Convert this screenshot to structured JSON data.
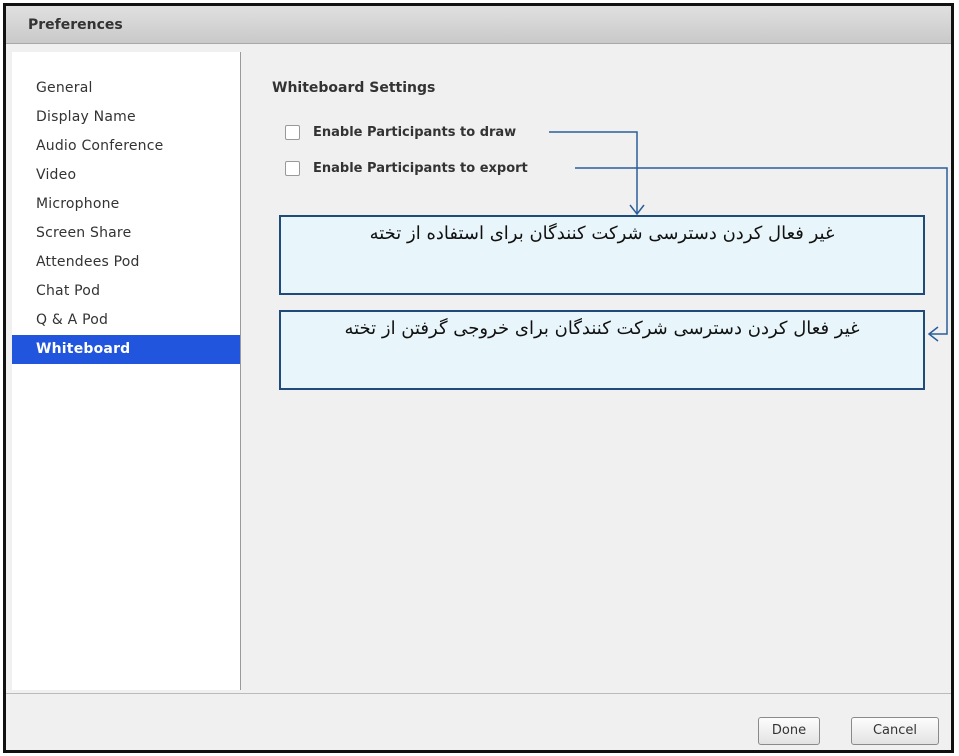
{
  "window": {
    "title": "Preferences"
  },
  "sidebar": {
    "items": [
      {
        "label": "General"
      },
      {
        "label": "Display Name"
      },
      {
        "label": "Audio Conference"
      },
      {
        "label": "Video"
      },
      {
        "label": "Microphone"
      },
      {
        "label": "Screen Share"
      },
      {
        "label": "Attendees Pod"
      },
      {
        "label": "Chat Pod"
      },
      {
        "label": "Q & A Pod"
      },
      {
        "label": "Whiteboard"
      }
    ],
    "selected": "Whiteboard"
  },
  "main": {
    "section_title": "Whiteboard Settings",
    "options": [
      {
        "label": "Enable Participants to draw",
        "checked": false
      },
      {
        "label": "Enable Participants to export",
        "checked": false
      }
    ]
  },
  "annotations": [
    {
      "text": "غیر فعال کردن دسترسی شرکت کنندگان برای استفاده از تخته"
    },
    {
      "text": "غیر فعال کردن دسترسی شرکت کنندگان برای خروجی گرفتن از تخته"
    }
  ],
  "footer": {
    "done_label": "Done",
    "cancel_label": "Cancel"
  },
  "colors": {
    "selection": "#2255dd",
    "annotation_border": "#1f4a7a",
    "annotation_fill": "#e8f6fb"
  }
}
